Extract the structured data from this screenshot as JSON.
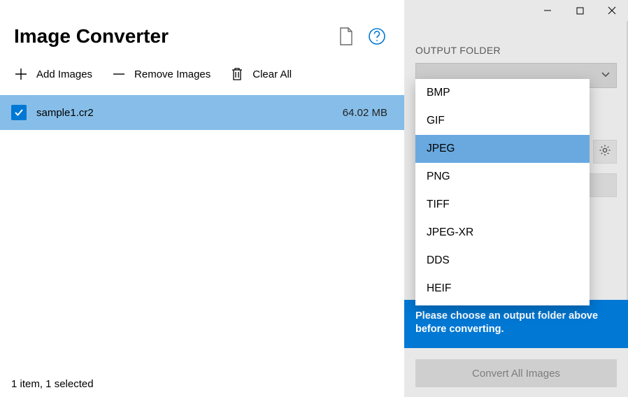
{
  "app": {
    "title": "Image Converter"
  },
  "toolbar": {
    "add_label": "Add Images",
    "remove_label": "Remove Images",
    "clear_label": "Clear All"
  },
  "files": [
    {
      "name": "sample1.cr2",
      "size": "64.02 MB",
      "checked": true
    }
  ],
  "status": {
    "text": "1 item, 1 selected"
  },
  "side": {
    "output_folder_label": "OUTPUT FOLDER",
    "warning_text": "Please choose an output folder above before converting.",
    "convert_label": "Convert All Images"
  },
  "format_dropdown": {
    "options": [
      "BMP",
      "GIF",
      "JPEG",
      "PNG",
      "TIFF",
      "JPEG-XR",
      "DDS",
      "HEIF"
    ],
    "selected_index": 2
  }
}
